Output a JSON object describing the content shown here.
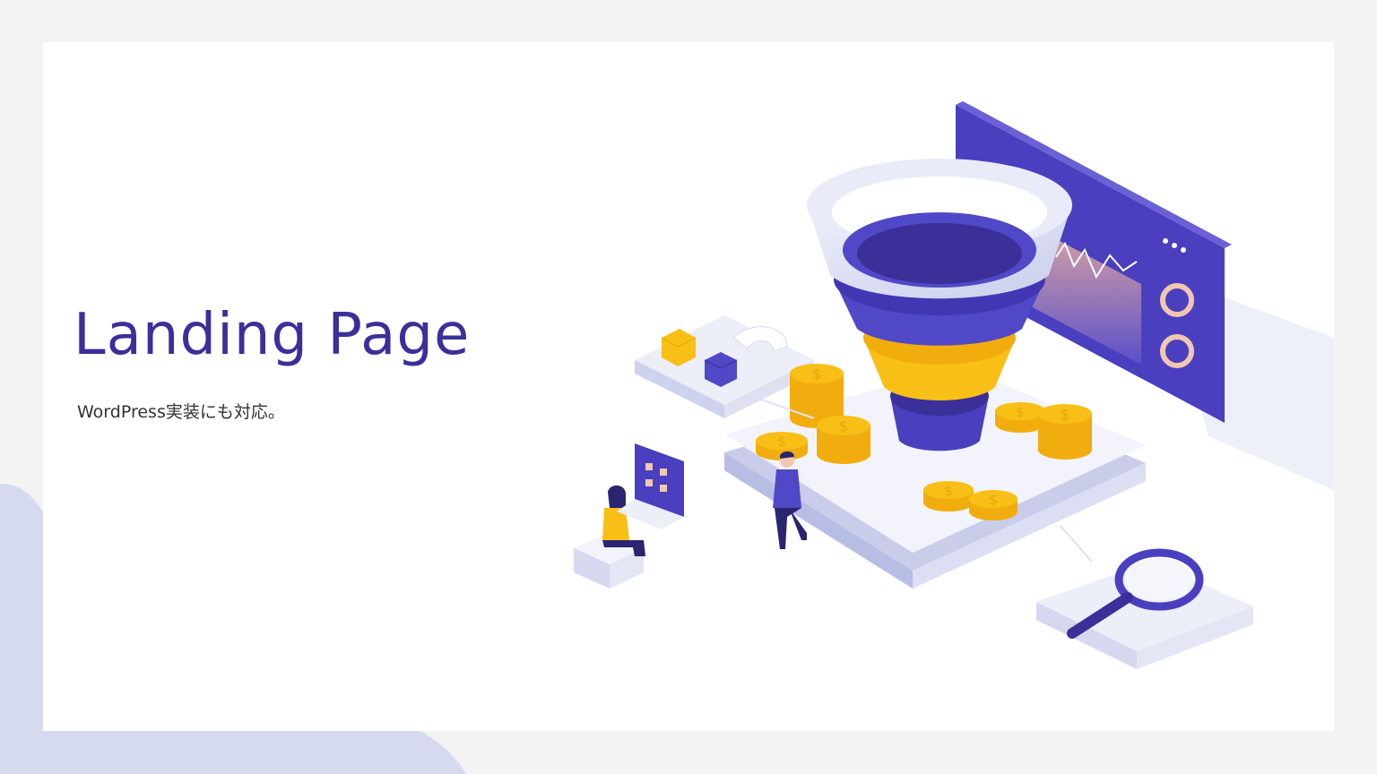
{
  "hero": {
    "title": "Landing Page",
    "subtitle": "WordPress実装にも対応。"
  },
  "illustration": {
    "icons": [
      "sales-funnel-icon",
      "gold-coin-icon",
      "analytics-dashboard-icon",
      "magnet-icon",
      "magnifying-glass-icon",
      "person-icon",
      "laptop-icon"
    ],
    "coin_symbol": "$"
  },
  "colors": {
    "page_background": "#f3f3f4",
    "card_background": "#ffffff",
    "accent_purple": "#3b2f9a",
    "funnel_purple": "#5148c7",
    "coin_yellow": "#f8bf16",
    "soft_lavender": "#d5d8ee"
  }
}
